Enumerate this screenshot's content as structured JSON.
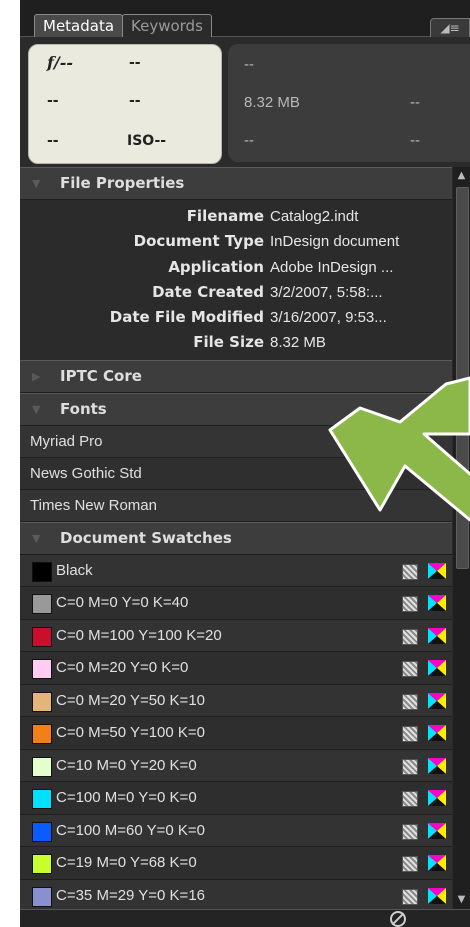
{
  "tabs": [
    {
      "label": "Metadata",
      "active": true
    },
    {
      "label": "Keywords",
      "active": false
    }
  ],
  "panel_menu_icon": "panel-menu-icon",
  "camera_data": {
    "aperture": "f/--",
    "shutter": "--",
    "r2c1": "--",
    "r2c2": "--",
    "r3c1": "--",
    "iso": "ISO--"
  },
  "file_data": {
    "r1c1": "--",
    "r2c1": "8.32 MB",
    "r2c2": "--",
    "r3c1": "--",
    "r3c2": "--"
  },
  "sections": {
    "file_properties": "File Properties",
    "iptc_core": "IPTC Core",
    "fonts": "Fonts",
    "document_swatches": "Document Swatches"
  },
  "file_properties": [
    {
      "key": "Filename",
      "value": "Catalog2.indt"
    },
    {
      "key": "Document Type",
      "value": "InDesign document"
    },
    {
      "key": "Application",
      "value": "Adobe InDesign ..."
    },
    {
      "key": "Date Created",
      "value": "3/2/2007, 5:58:..."
    },
    {
      "key": "Date File Modified",
      "value": "3/16/2007, 9:53..."
    },
    {
      "key": "File Size",
      "value": "8.32 MB"
    }
  ],
  "fonts": [
    "Myriad Pro",
    "News Gothic Std",
    "Times New Roman"
  ],
  "swatches": [
    {
      "name": "Black",
      "color": "#000000"
    },
    {
      "name": "C=0 M=0 Y=0 K=40",
      "color": "#999999"
    },
    {
      "name": "C=0 M=100 Y=100 K=20",
      "color": "#c8102e"
    },
    {
      "name": "C=0 M=20 Y=0 K=0",
      "color": "#ffccf2"
    },
    {
      "name": "C=0 M=20 Y=50 K=10",
      "color": "#e3b578"
    },
    {
      "name": "C=0 M=50 Y=100 K=0",
      "color": "#f57f17"
    },
    {
      "name": "C=10 M=0 Y=20 K=0",
      "color": "#e5ffcc"
    },
    {
      "name": "C=100 M=0 Y=0 K=0",
      "color": "#00e0ff"
    },
    {
      "name": "C=100 M=60 Y=0 K=0",
      "color": "#0a5cff"
    },
    {
      "name": "C=19 M=0 Y=68 K=0",
      "color": "#c8ff2a"
    },
    {
      "name": "C=35 M=29 Y=0 K=16",
      "color": "#8a8fd0"
    },
    {
      "name": "",
      "color": "#ffffff"
    }
  ],
  "colors": {
    "panel_bg": "#2b2b2b",
    "header_bg": "#3d3d3d",
    "exif_bg": "#eaeadf",
    "arrow_fill": "#8cb84a",
    "arrow_stroke": "#ffffff"
  }
}
